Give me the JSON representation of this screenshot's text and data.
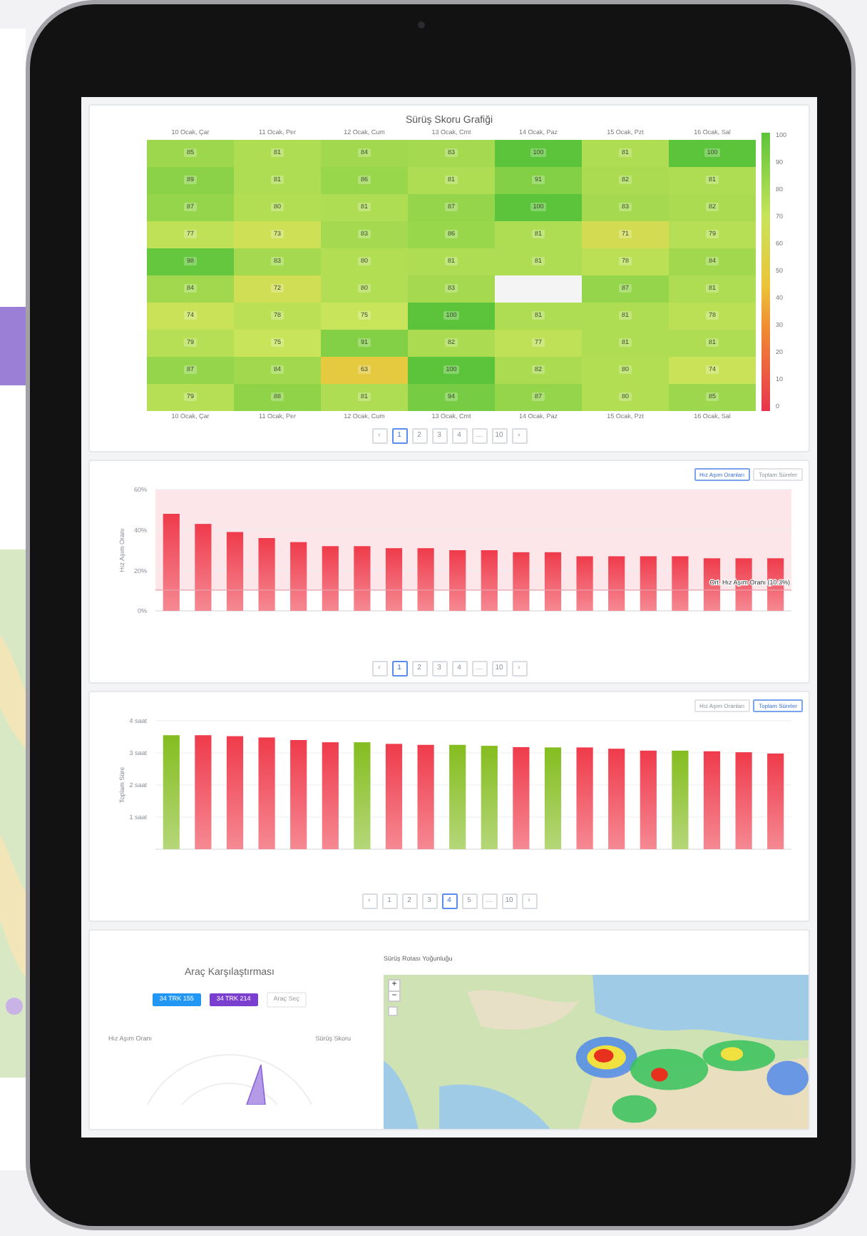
{
  "heatmap": {
    "title": "Sürüş Skoru Grafiği",
    "columns": [
      "10 Ocak, Çar",
      "11 Ocak, Per",
      "12 Ocak, Cum",
      "13 Ocak, Cmt",
      "14 Ocak, Paz",
      "15 Ocak, Pzt",
      "16 Ocak, Sal"
    ],
    "rows": [
      [
        "85",
        "81",
        "84",
        "83",
        "100",
        "81",
        "100"
      ],
      [
        "89",
        "81",
        "86",
        "81",
        "91",
        "82",
        "81"
      ],
      [
        "87",
        "80",
        "81",
        "87",
        "100",
        "83",
        "82"
      ],
      [
        "77",
        "73",
        "83",
        "86",
        "81",
        "71",
        "79"
      ],
      [
        "98",
        "83",
        "80",
        "81",
        "81",
        "78",
        "84"
      ],
      [
        "84",
        "72",
        "80",
        "83",
        null,
        "87",
        "81"
      ],
      [
        "74",
        "78",
        "75",
        "100",
        "81",
        "81",
        "78"
      ],
      [
        "79",
        "75",
        "91",
        "82",
        "77",
        "81",
        "81"
      ],
      [
        "87",
        "84",
        "63",
        "100",
        "82",
        "80",
        "74"
      ],
      [
        "79",
        "88",
        "81",
        "94",
        "87",
        "80",
        "85"
      ]
    ],
    "footer_columns": [
      "10 Ocak, Çar",
      "11 Ocak, Per",
      "12 Ocak, Cum",
      "13 Ocak, Cmt",
      "14 Ocak, Paz",
      "15 Ocak, Pzt",
      "16 Ocak, Sal"
    ],
    "scale_ticks": [
      "100",
      "90",
      "80",
      "70",
      "60",
      "50",
      "40",
      "30",
      "20",
      "10",
      "0"
    ],
    "pagination": [
      {
        "label": "‹",
        "selected": false
      },
      {
        "label": "1",
        "selected": true
      },
      {
        "label": "2",
        "selected": false
      },
      {
        "label": "3",
        "selected": false
      },
      {
        "label": "4",
        "selected": false
      },
      {
        "label": "…",
        "selected": false
      },
      {
        "label": "10",
        "selected": false
      },
      {
        "label": "›",
        "selected": false
      }
    ]
  },
  "speeding_chart": {
    "toggles": [
      {
        "label": "Hız Aşım Oranları",
        "selected": true
      },
      {
        "label": "Toplam Süreler",
        "selected": false
      }
    ],
    "chart_data": {
      "type": "bar",
      "ylabel": "Hız Aşım Oranı",
      "ylim": [
        0,
        60
      ],
      "yticks": [
        {
          "value": 0,
          "label": "0%"
        },
        {
          "value": 20,
          "label": "20%"
        },
        {
          "value": 40,
          "label": "40%"
        },
        {
          "value": 60,
          "label": "60%"
        }
      ],
      "series": [
        {
          "color": "#ef3b4b",
          "values": [
            48,
            43,
            39,
            36,
            34,
            32,
            32,
            31,
            31,
            30,
            30,
            29,
            29,
            27,
            27,
            27,
            27,
            26,
            26,
            26
          ]
        }
      ],
      "grid": true,
      "ref_lines": [
        {
          "axis": "y",
          "value": 10.3,
          "label": "Ort. Hız Aşım Oranı (10.3%)"
        }
      ]
    },
    "pagination": [
      {
        "label": "‹",
        "selected": false
      },
      {
        "label": "1",
        "selected": true
      },
      {
        "label": "2",
        "selected": false
      },
      {
        "label": "3",
        "selected": false
      },
      {
        "label": "4",
        "selected": false
      },
      {
        "label": "…",
        "selected": false
      },
      {
        "label": "10",
        "selected": false
      },
      {
        "label": "›",
        "selected": false
      }
    ]
  },
  "duration_chart": {
    "toggles": [
      {
        "label": "Hız Aşım Oranları",
        "selected": false
      },
      {
        "label": "Toplam Süreler",
        "selected": true
      }
    ],
    "chart_data": {
      "type": "bar",
      "grid": true,
      "ylabel": "Toplam Süre",
      "ylim": [
        0,
        4
      ],
      "yticks": [
        {
          "value": 1,
          "label": "1 saat"
        },
        {
          "value": 2,
          "label": "2 saat"
        },
        {
          "value": 3,
          "label": "3 saat"
        },
        {
          "value": 4,
          "label": "4 saat"
        }
      ],
      "series": [
        {
          "color": "#84bd1f",
          "values": [
            3.55,
            null,
            null,
            null,
            null,
            null,
            3.33,
            null,
            null,
            3.25,
            3.22,
            null,
            3.17,
            null,
            null,
            null,
            3.07,
            null,
            null,
            null
          ]
        },
        {
          "color": "#ef3b4b",
          "values": [
            null,
            3.55,
            3.52,
            3.48,
            3.4,
            3.33,
            null,
            3.28,
            3.25,
            null,
            null,
            3.18,
            null,
            3.17,
            3.13,
            3.07,
            null,
            3.05,
            3.02,
            2.98
          ]
        }
      ]
    },
    "pagination": [
      {
        "label": "‹",
        "selected": false
      },
      {
        "label": "1",
        "selected": false
      },
      {
        "label": "2",
        "selected": false
      },
      {
        "label": "3",
        "selected": false
      },
      {
        "label": "4",
        "selected": true
      },
      {
        "label": "5",
        "selected": false
      },
      {
        "label": "…",
        "selected": false
      },
      {
        "label": "10",
        "selected": false
      },
      {
        "label": "›",
        "selected": false
      }
    ]
  },
  "comparison": {
    "title": "Araç Karşılaştırması",
    "chips": [
      {
        "label": "34 TRK 155",
        "color": "#2196f3"
      },
      {
        "label": "34 TRK 214",
        "color": "#7b3fd0"
      }
    ],
    "select_label": "Araç Seç",
    "axes": [
      "Hız Aşım Oranı",
      "Sürüş Skoru"
    ]
  },
  "map": {
    "title": "Sürüş Rotası Yoğunluğu",
    "zoom_in": "+",
    "zoom_out": "−"
  }
}
